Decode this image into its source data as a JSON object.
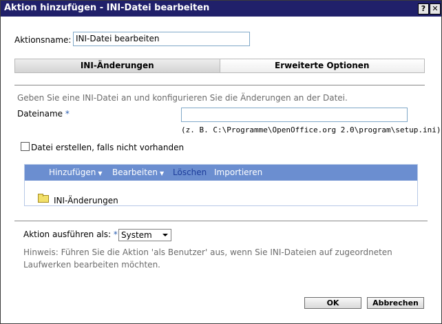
{
  "window": {
    "title": "Aktion hinzufügen - INI-Datei bearbeiten",
    "help_label": "?",
    "close_label": "✕"
  },
  "action_name": {
    "label": "Aktionsname:",
    "value": "INI-Datei bearbeiten"
  },
  "tabs": [
    {
      "label": "INI-Änderungen",
      "active": true
    },
    {
      "label": "Erweiterte Optionen",
      "active": false
    }
  ],
  "description": "Geben Sie eine INI-Datei an und konfigurieren Sie die Änderungen an der Datei.",
  "filename": {
    "label": "Dateiname",
    "required_mark": "*",
    "value": "",
    "example": "(z. B. C:\\Programme\\OpenOffice.org 2.0\\program\\setup.ini)"
  },
  "create_file": {
    "label": "Datei erstellen, falls nicht vorhanden",
    "checked": false
  },
  "panel": {
    "menu": {
      "add": "Hinzufügen",
      "edit": "Bearbeiten",
      "delete": "Löschen",
      "import": "Importieren"
    },
    "tree_item": "INI-Änderungen",
    "bar_color": "#6b8ed0"
  },
  "run_as": {
    "label": "Aktion ausführen als:",
    "required_mark": "*",
    "selected": "System"
  },
  "hint": "Hinweis: Führen Sie die Aktion 'als Benutzer' aus, wenn Sie INI-Dateien auf zugeordneten Laufwerken bearbeiten möchten.",
  "buttons": {
    "ok": "OK",
    "cancel": "Abbrechen"
  },
  "colors": {
    "titlebar": "#20206a",
    "required": "#2a5db0",
    "hint_text": "#6b6b6b"
  }
}
